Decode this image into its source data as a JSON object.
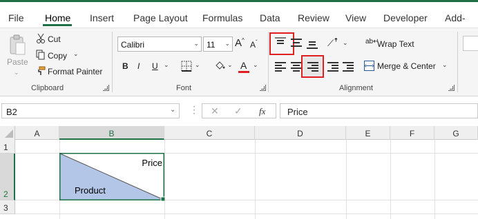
{
  "tabs": [
    "File",
    "Home",
    "Insert",
    "Page Layout",
    "Formulas",
    "Data",
    "Review",
    "View",
    "Developer",
    "Add-"
  ],
  "active_tab": "Home",
  "clipboard": {
    "paste": "Paste",
    "cut": "Cut",
    "copy": "Copy",
    "format_painter": "Format Painter",
    "group_label": "Clipboard"
  },
  "font": {
    "name": "Calibri",
    "size": "11",
    "bold": "B",
    "italic": "I",
    "underline": "U",
    "font_color_letter": "A",
    "grow": "A",
    "shrink": "A",
    "group_label": "Font"
  },
  "alignment": {
    "wrap_text": "Wrap Text",
    "merge_center": "Merge & Center",
    "group_label": "Alignment",
    "highlighted": [
      "top-align",
      "align-right"
    ]
  },
  "formula_bar": {
    "name_box": "B2",
    "fx": "fx",
    "formula": "Price"
  },
  "grid": {
    "columns": [
      "A",
      "B",
      "C",
      "D",
      "E",
      "F",
      "G"
    ],
    "rows": [
      "1",
      "2",
      "3"
    ],
    "selected_column": "B",
    "selected_row": "2",
    "cell_b2": {
      "top_right_text": "Price",
      "bottom_left_text": "Product",
      "fill_color": "#b4c6e7"
    }
  },
  "colors": {
    "accent": "#1f7145",
    "highlight": "#e02020",
    "font_color_bar": "#e02020"
  }
}
